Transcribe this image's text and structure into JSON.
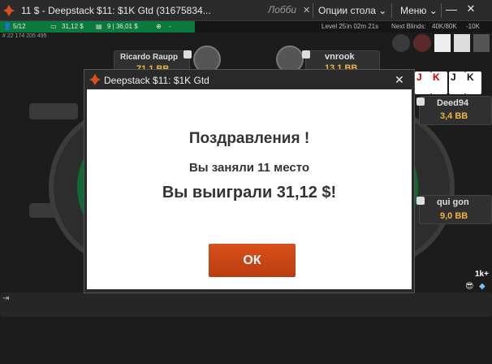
{
  "window": {
    "title": "11 $ - Deepstack $11: $1K Gtd  (31675834...",
    "lobby_tab": "Лобби",
    "table_options_label": "Опции стола",
    "menu_label": "Меню",
    "minimize_label": "—",
    "close_label": "✕",
    "pin_label": "✕",
    "chevron": "⌄"
  },
  "status": {
    "players": "5/12",
    "prize": "31,12 $",
    "tickets": "9 | 36,01 $",
    "dash": "-",
    "level": "Level 25",
    "time": "in 02m 21s",
    "next_blinds_label": "Next Blinds:",
    "next_blinds_value": "40K/80K",
    "ante": "-10K",
    "tournament_id": "# 22 174 205 495"
  },
  "players": {
    "ricardo": {
      "name": "Ricardo Raupp",
      "stack": "71,1 BB"
    },
    "vnrook": {
      "name": "vnrook",
      "stack": "13,1 BB"
    },
    "deed": {
      "name": "Deed94",
      "stack": "3,4 BB"
    },
    "quigon": {
      "name": "qui gon",
      "stack": "9,0 BB"
    }
  },
  "side": {
    "count": "1k+"
  },
  "modal": {
    "title": "Deepstack $11: $1K Gtd",
    "close_label": "✕",
    "congrats": "Поздравления !",
    "place": "Вы заняли 11 место",
    "won": "Вы выиграли 31,12 $!",
    "ok_label": "ОК"
  },
  "colors": {
    "accent": "#d9501a",
    "stack": "#f0b63c",
    "status_green": "#0a7a3c"
  },
  "icons": [
    "brand-logo-icon",
    "pin-icon",
    "minimize-icon",
    "close-icon",
    "players-icon",
    "prize-icon",
    "chips-icon",
    "crosshair-icon",
    "note-icon",
    "exit-icon",
    "emoji-icon",
    "diamond-icon"
  ]
}
